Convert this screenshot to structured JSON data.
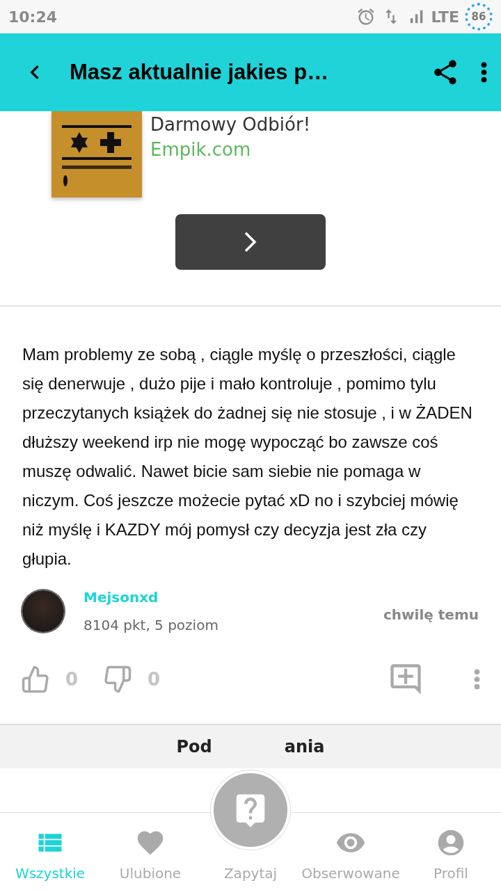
{
  "status_bar": {
    "time": "10:24",
    "network": "LTE",
    "battery": "86"
  },
  "header": {
    "title": "Masz aktualnie jakies p…"
  },
  "ad": {
    "headline": "Darmowy Odbiór!",
    "source": "Empik.com"
  },
  "post": {
    "text": "Mam problemy ze sobą , ciągle myślę o przeszłości, ciągle się denerwuje , dużo pije i mało kontroluje , pomimo tylu przeczytanych książek do żadnej się nie stosuje , i w ŻADEN dłuższy weekend irp nie mogę wypocząć bo zawsze coś muszę odwalić. Nawet bicie sam siebie nie pomaga w niczym. Coś jeszcze możecie pytać xD no i szybciej mówię niż myślę i KAZDY mój pomysł czy decyzja jest zła czy głupia.",
    "author": "Mejsonxd",
    "stats": "8104 pkt, 5 poziom",
    "time": "chwilę temu",
    "likes": "0",
    "dislikes": "0"
  },
  "related": {
    "title_start": "Pod",
    "title_end": "ania"
  },
  "nav": [
    {
      "label": "Wszystkie",
      "kind": "tab",
      "selected": true
    },
    {
      "label": "Ulubione",
      "kind": "tab",
      "selected": false
    },
    {
      "label": "Zapytaj",
      "kind": "fab",
      "selected": false
    },
    {
      "label": "Obserwowane",
      "kind": "tab",
      "selected": false
    },
    {
      "label": "Profil",
      "kind": "tab",
      "selected": false
    }
  ]
}
